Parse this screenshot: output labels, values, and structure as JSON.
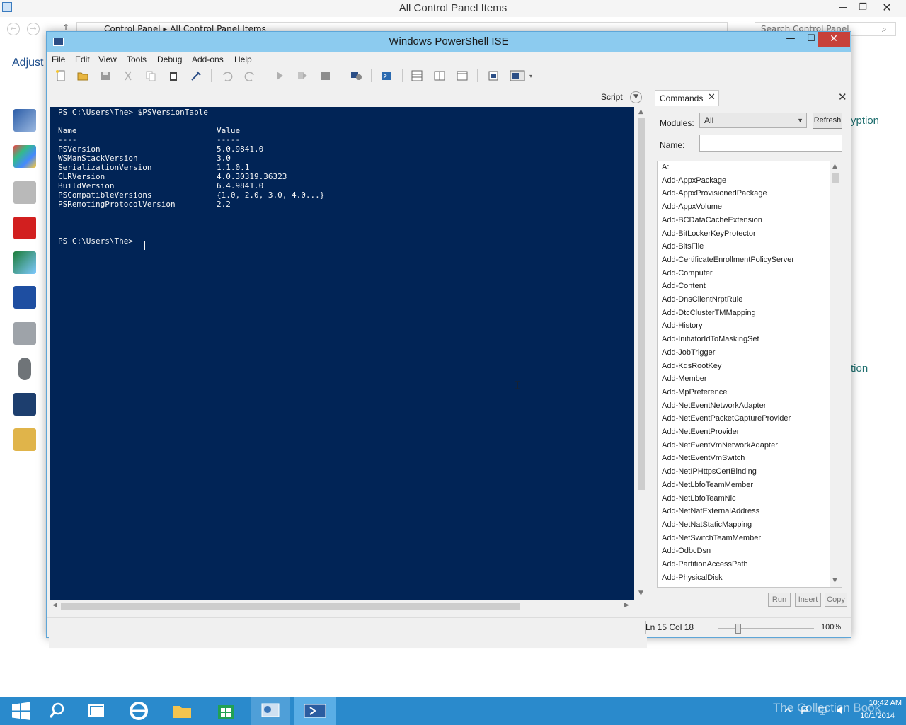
{
  "control_panel": {
    "title": "All Control Panel Items",
    "breadcrumb": "Control Panel  ▸  All Control Panel Items",
    "search_placeholder": "Search Control Panel",
    "heading_partial": "Adjust",
    "right_text_1": "yption",
    "right_text_2": "tion"
  },
  "ise": {
    "title": "Windows PowerShell ISE",
    "menu": [
      "File",
      "Edit",
      "View",
      "Tools",
      "Debug",
      "Add-ons",
      "Help"
    ],
    "script_label": "Script",
    "console": {
      "prompt_cmd": "PS C:\\Users\\The> $PSVersionTable",
      "header_name": "Name",
      "header_value": "Value",
      "rule_name": "----",
      "rule_value": "-----",
      "rows": [
        {
          "name": "PSVersion",
          "value": "5.0.9841.0"
        },
        {
          "name": "WSManStackVersion",
          "value": "3.0"
        },
        {
          "name": "SerializationVersion",
          "value": "1.1.0.1"
        },
        {
          "name": "CLRVersion",
          "value": "4.0.30319.36323"
        },
        {
          "name": "BuildVersion",
          "value": "6.4.9841.0"
        },
        {
          "name": "PSCompatibleVersions",
          "value": "{1.0, 2.0, 3.0, 4.0...}"
        },
        {
          "name": "PSRemotingProtocolVersion",
          "value": "2.2"
        }
      ],
      "prompt_current": "PS C:\\Users\\The> "
    },
    "commands": {
      "tab_label": "Commands",
      "modules_label": "Modules:",
      "modules_value": "All",
      "refresh_label": "Refresh",
      "name_label": "Name:",
      "name_value": "",
      "items": [
        "A:",
        "Add-AppxPackage",
        "Add-AppxProvisionedPackage",
        "Add-AppxVolume",
        "Add-BCDataCacheExtension",
        "Add-BitLockerKeyProtector",
        "Add-BitsFile",
        "Add-CertificateEnrollmentPolicyServer",
        "Add-Computer",
        "Add-Content",
        "Add-DnsClientNrptRule",
        "Add-DtcClusterTMMapping",
        "Add-History",
        "Add-InitiatorIdToMaskingSet",
        "Add-JobTrigger",
        "Add-KdsRootKey",
        "Add-Member",
        "Add-MpPreference",
        "Add-NetEventNetworkAdapter",
        "Add-NetEventPacketCaptureProvider",
        "Add-NetEventProvider",
        "Add-NetEventVmNetworkAdapter",
        "Add-NetEventVmSwitch",
        "Add-NetIPHttpsCertBinding",
        "Add-NetLbfoTeamMember",
        "Add-NetLbfoTeamNic",
        "Add-NetNatExternalAddress",
        "Add-NetNatStaticMapping",
        "Add-NetSwitchTeamMember",
        "Add-OdbcDsn",
        "Add-PartitionAccessPath",
        "Add-PhysicalDisk"
      ],
      "run_label": "Run",
      "insert_label": "Insert",
      "copy_label": "Copy"
    },
    "status": {
      "position": "Ln 15  Col 18",
      "zoom": "100%",
      "zoom_level": 1.0
    }
  },
  "taskbar": {
    "watermark": "The Collection Book",
    "time": "10:42 AM",
    "date": "10/1/2014",
    "apps": [
      "start",
      "search",
      "task-view",
      "internet-explorer",
      "file-explorer",
      "store",
      "control-panel",
      "powershell"
    ]
  },
  "colors": {
    "console_bg": "#012456",
    "titlebar": "#8ccbef",
    "close_red": "#c7413a",
    "taskbar": "#2a8acc"
  }
}
